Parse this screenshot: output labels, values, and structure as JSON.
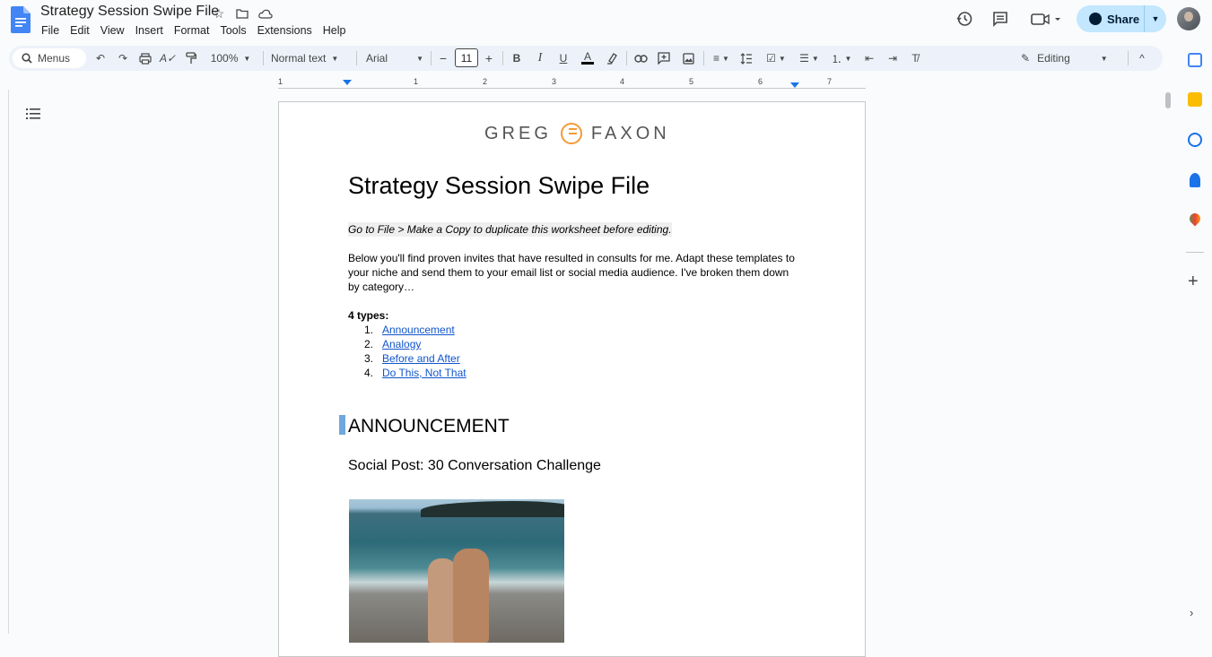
{
  "window": {
    "doc_title": "Strategy Session Swipe File"
  },
  "menu": [
    "File",
    "Edit",
    "View",
    "Insert",
    "Format",
    "Tools",
    "Extensions",
    "Help"
  ],
  "header": {
    "share_label": "Share"
  },
  "toolbar": {
    "menus_label": "Menus",
    "zoom": "100%",
    "style": "Normal text",
    "font": "Arial",
    "font_size": "11",
    "mode": "Editing"
  },
  "ruler": {
    "marks": [
      "1",
      "1",
      "2",
      "3",
      "4",
      "5",
      "6",
      "7"
    ]
  },
  "document": {
    "logo_left": "GREG",
    "logo_right": "FAXON",
    "title": "Strategy Session Swipe File",
    "hint": "Go to File > Make a Copy to duplicate this worksheet before editing.",
    "intro": "Below you'll find proven invites that have resulted in consults for me. Adapt these templates to your niche and send them to your email list or social media audience. I've broken them down by category…",
    "types_label": "4 types:",
    "types": [
      {
        "num": "1.",
        "label": "Announcement"
      },
      {
        "num": "2.",
        "label": "Analogy"
      },
      {
        "num": "3.",
        "label": "Before and After"
      },
      {
        "num": "4.",
        "label": "Do This, Not That"
      }
    ],
    "section_heading": "ANNOUNCEMENT",
    "subheading": "Social Post: 30 Conversation Challenge"
  },
  "colors": {
    "link": "#1155cc",
    "share_bg": "#c2e7ff",
    "toolbar_bg": "#edf2fa",
    "logo_accent": "#f29a38"
  }
}
